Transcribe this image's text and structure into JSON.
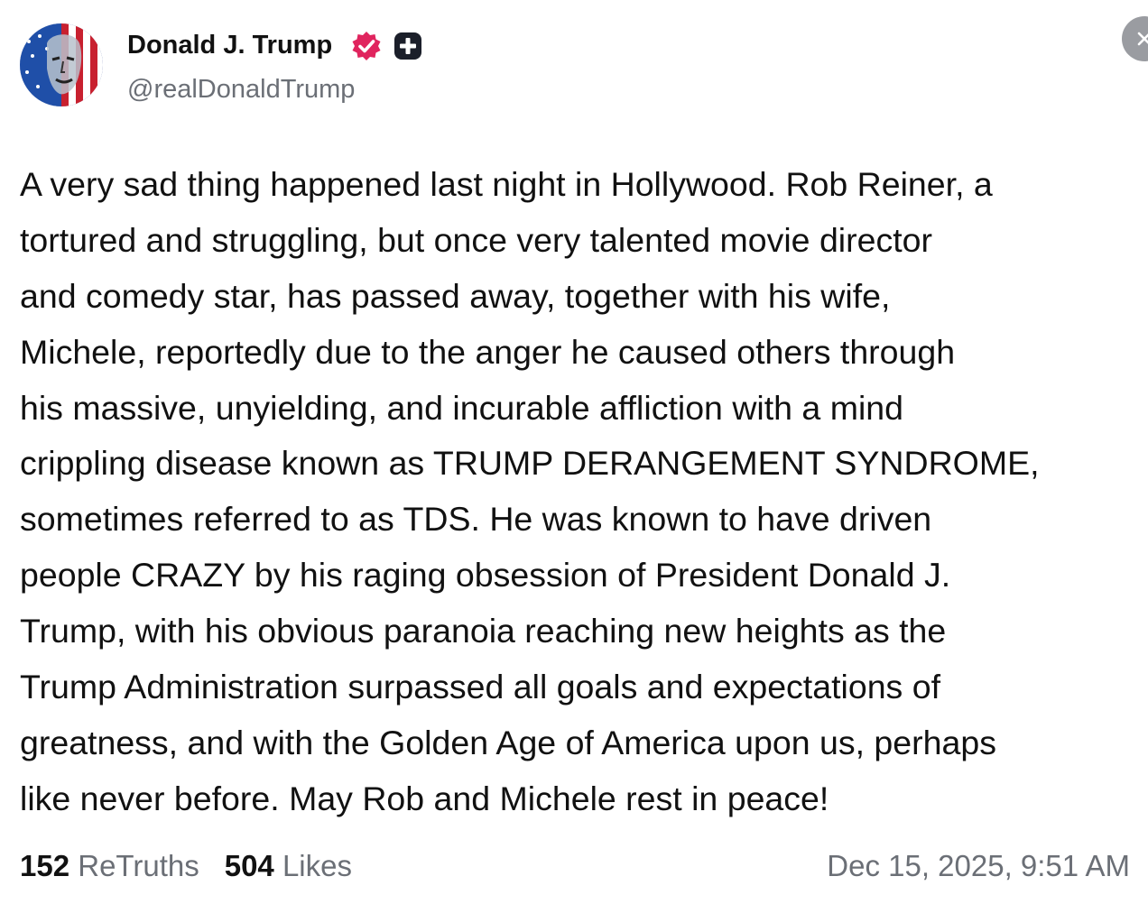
{
  "author": {
    "display_name": "Donald J. Trump",
    "handle": "@realDonaldTrump",
    "verified_icon": "verified-badge-icon",
    "verified_color": "#e0245e",
    "plus_icon": "plus-badge-icon"
  },
  "post": {
    "lines": [
      "A very sad thing happened last night in Hollywood. Rob Reiner, a",
      "tortured and struggling, but once very talented movie director",
      "and comedy star, has passed away, together with his wife,",
      "Michele, reportedly due to the anger he caused others through",
      "his massive, unyielding, and incurable affliction with a mind",
      "crippling disease known as TRUMP DERANGEMENT SYNDROME,",
      "sometimes referred to as TDS. He was known to have driven",
      "people CRAZY by his raging obsession of President Donald J.",
      "Trump, with his obvious paranoia reaching new heights as the",
      "Trump Administration surpassed all goals and expectations of",
      "greatness, and with the Golden Age of America upon us, perhaps",
      "like never before. May Rob and Michele rest in peace!"
    ]
  },
  "stats": {
    "retruths_count": "152",
    "retruths_label": "ReTruths",
    "likes_count": "504",
    "likes_label": "Likes"
  },
  "timestamp": "Dec 15, 2025, 9:51 AM",
  "close_icon": "close-icon"
}
